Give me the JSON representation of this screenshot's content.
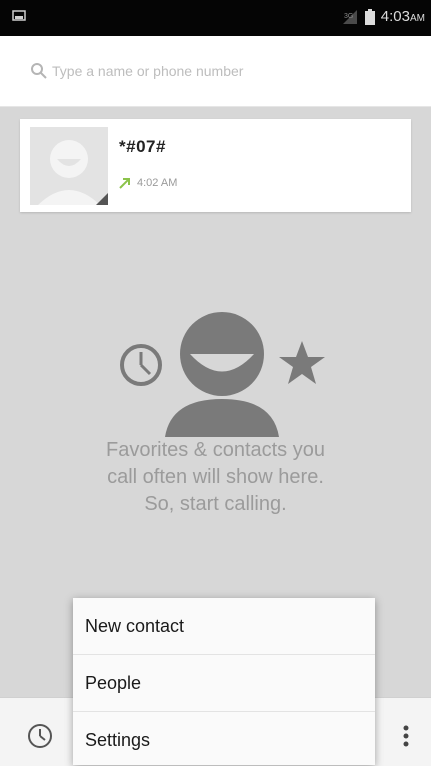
{
  "status_bar": {
    "time": "4:03",
    "time_suffix": "AM"
  },
  "search": {
    "placeholder": "Type a name or phone number"
  },
  "recent_call": {
    "number": "*#07#",
    "time": "4:02 AM"
  },
  "empty_state": {
    "message": "Favorites & contacts you\ncall often will show here.\nSo, start calling."
  },
  "menu": {
    "items": [
      {
        "label": "New contact"
      },
      {
        "label": "People"
      },
      {
        "label": "Settings"
      }
    ]
  },
  "icons": {
    "search": "search-icon",
    "avatar": "person-placeholder-icon",
    "outgoing": "outgoing-call-arrow-icon",
    "history": "clock-icon",
    "overflow": "more-vert-icon"
  },
  "colors": {
    "outgoing_arrow": "#8bc34a",
    "illustration": "#7a7a7a",
    "background": "#d7d7d7"
  }
}
